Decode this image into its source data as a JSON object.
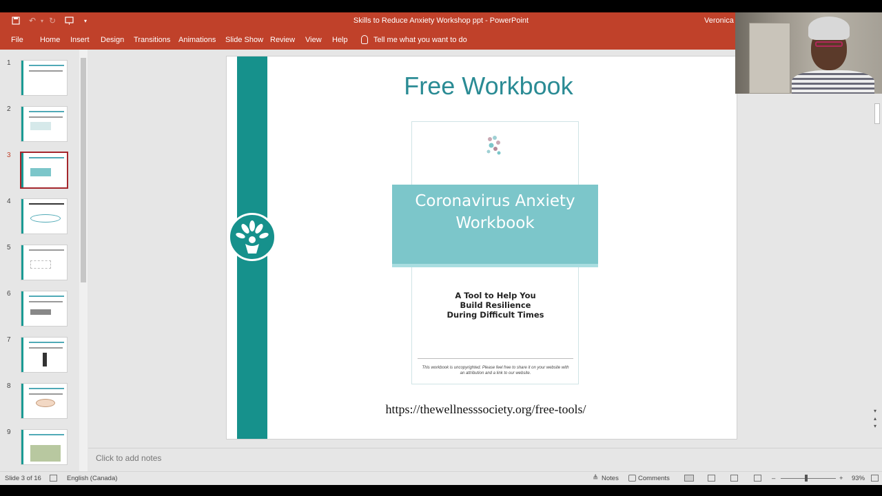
{
  "window": {
    "title": "Skills to Reduce Anxiety Workshop ppt  -  PowerPoint",
    "user": "Veronica T"
  },
  "ribbon": {
    "tabs": [
      "File",
      "Home",
      "Insert",
      "Design",
      "Transitions",
      "Animations",
      "Slide Show",
      "Review",
      "View",
      "Help"
    ],
    "tell_me": "Tell me what you want to do"
  },
  "thumbnails": {
    "numbers": [
      "1",
      "2",
      "3",
      "4",
      "5",
      "6",
      "7",
      "8",
      "9"
    ],
    "active_index": 3
  },
  "slide": {
    "title": "Free Workbook",
    "book_title": "Coronavirus Anxiety Workbook",
    "book_subtitle": "A Tool to Help You Build Resilience During Difficult Times",
    "book_fineprint": "This workbook is uncopyrighted. Please feel free to share it on your website with an attribution and a link to our website.",
    "url": "https://thewellnesssociety.org/free-tools/"
  },
  "notes": {
    "placeholder": "Click to add notes"
  },
  "status": {
    "slide_counter": "Slide 3 of 16",
    "language": "English (Canada)",
    "notes_label": "Notes",
    "comments_label": "Comments",
    "zoom": "93%"
  },
  "colors": {
    "ribbon": "#c0412a",
    "slide_accent": "#16918c",
    "title_teal": "#2a8b94",
    "banner": "#7cc6ca"
  }
}
